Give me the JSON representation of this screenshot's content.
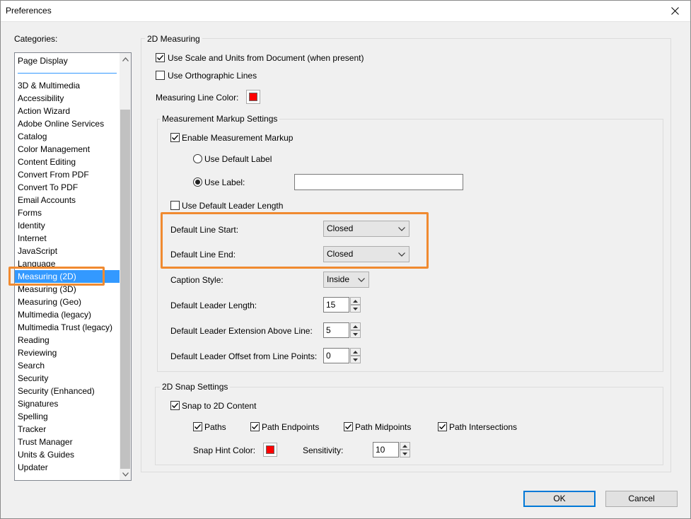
{
  "window": {
    "title": "Preferences"
  },
  "categories": {
    "label": "Categories:",
    "top_item": "Page Display",
    "items": [
      "3D & Multimedia",
      "Accessibility",
      "Action Wizard",
      "Adobe Online Services",
      "Catalog",
      "Color Management",
      "Content Editing",
      "Convert From PDF",
      "Convert To PDF",
      "Email Accounts",
      "Forms",
      "Identity",
      "Internet",
      "JavaScript",
      "Language",
      "Measuring (2D)",
      "Measuring (3D)",
      "Measuring (Geo)",
      "Multimedia (legacy)",
      "Multimedia Trust (legacy)",
      "Reading",
      "Reviewing",
      "Search",
      "Security",
      "Security (Enhanced)",
      "Signatures",
      "Spelling",
      "Tracker",
      "Trust Manager",
      "Units & Guides",
      "Updater"
    ],
    "selected": "Measuring (2D)"
  },
  "measuring": {
    "group_title": "2D Measuring",
    "use_scale_label": "Use Scale and Units from Document (when present)",
    "use_scale_checked": true,
    "ortho_label": "Use Orthographic Lines",
    "ortho_checked": false,
    "line_color_label": "Measuring Line Color:",
    "line_color": "#ff0000"
  },
  "markup": {
    "group_title": "Measurement Markup Settings",
    "enable_label": "Enable Measurement Markup",
    "enable_checked": true,
    "default_label_option": "Use Default Label",
    "use_label_option": "Use Label:",
    "label_value": "",
    "default_leader_label": "Use Default Leader Length",
    "default_leader_checked": false,
    "line_start_label": "Default Line Start:",
    "line_start_value": "Closed",
    "line_end_label": "Default Line End:",
    "line_end_value": "Closed",
    "caption_label": "Caption Style:",
    "caption_value": "Inside",
    "leader_length_label": "Default Leader Length:",
    "leader_length_value": "15",
    "leader_ext_label": "Default Leader Extension Above Line:",
    "leader_ext_value": "5",
    "leader_offset_label": "Default Leader Offset from Line Points:",
    "leader_offset_value": "0"
  },
  "snap": {
    "group_title": "2D Snap Settings",
    "snap_label": "Snap to 2D Content",
    "paths_label": "Paths",
    "endpoints_label": "Path Endpoints",
    "midpoints_label": "Path Midpoints",
    "intersections_label": "Path Intersections",
    "hint_color_label": "Snap Hint Color:",
    "hint_color": "#ff0000",
    "sensitivity_label": "Sensitivity:",
    "sensitivity_value": "10"
  },
  "buttons": {
    "ok": "OK",
    "cancel": "Cancel"
  },
  "accent": {
    "highlight": "#f08a30",
    "selection": "#3399ff"
  }
}
